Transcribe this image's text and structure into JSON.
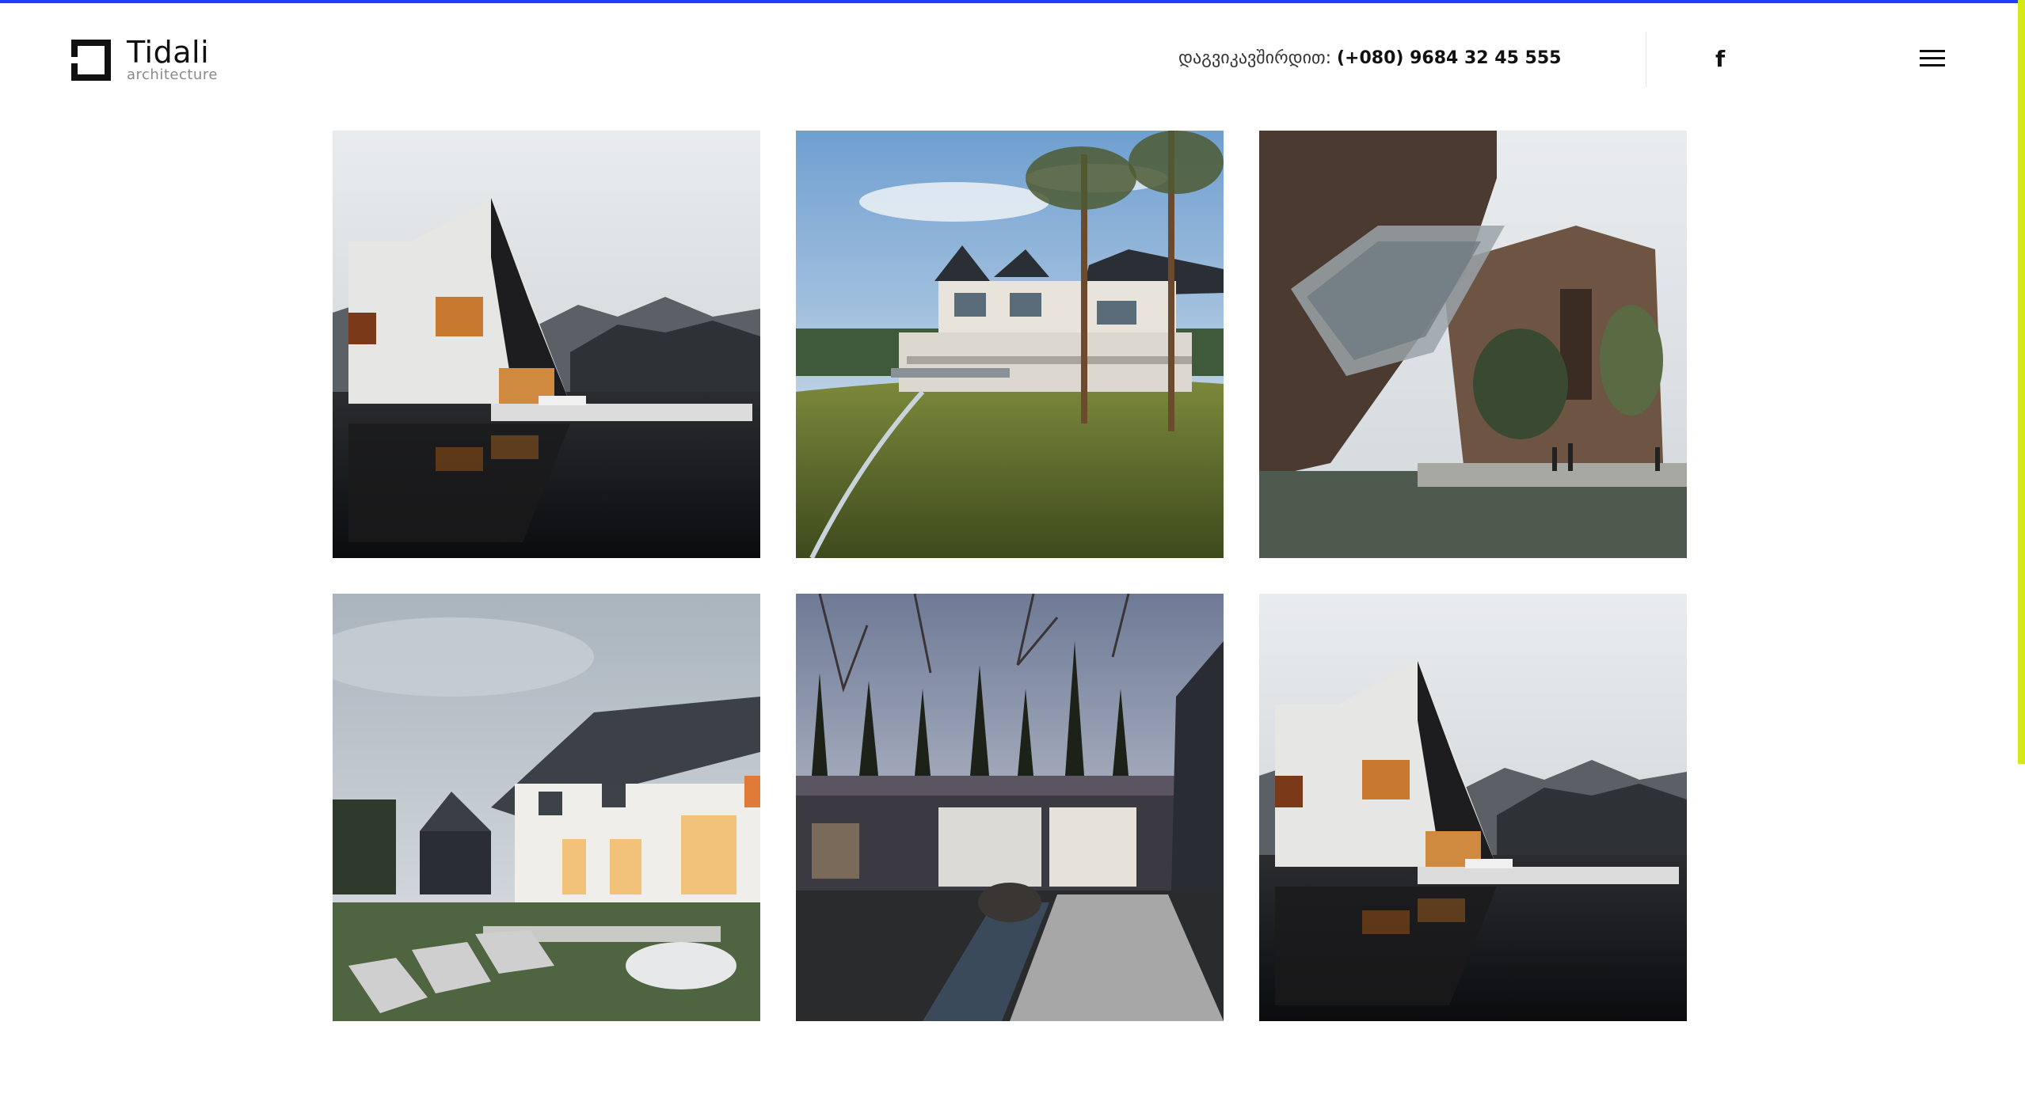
{
  "header": {
    "logo_name": "Tidali",
    "logo_sub": "architecture",
    "contact_label": "დაგვიკავშირდით:",
    "contact_phone": "(+080) 9684 32 45 555",
    "facebook_glyph": "f",
    "menu_icon": "hamburger-icon"
  },
  "colors": {
    "top_accent": "#1f3fff",
    "side_accent": "#d5e81a"
  },
  "gallery": {
    "items": [
      {
        "scene": "modern-lake-house"
      },
      {
        "scene": "wooden-villa-pines"
      },
      {
        "scene": "tilted-facade-plaza"
      },
      {
        "scene": "gabled-house-garden"
      },
      {
        "scene": "courtyard-cypress"
      },
      {
        "scene": "modern-lake-house"
      }
    ]
  }
}
